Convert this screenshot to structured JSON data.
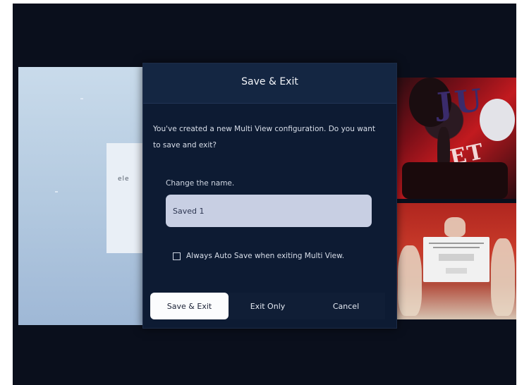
{
  "left_preview": {
    "card_text": "ele"
  },
  "right_top": {
    "letters": "JU",
    "letters2": "ET"
  },
  "dialog": {
    "title": "Save & Exit",
    "message": "You've created a new Multi View configuration. Do you want to save and exit?",
    "name_label": "Change the name.",
    "name_value": "Saved 1",
    "checkbox_label": "Always Auto Save when exiting Multi View.",
    "checkbox_checked": false,
    "buttons": {
      "save_exit": "Save & Exit",
      "exit_only": "Exit Only",
      "cancel": "Cancel"
    }
  },
  "colors": {
    "screen_bg": "#0a0f1c",
    "dialog_bg": "#0d1b33",
    "dialog_header": "#142642",
    "input_bg": "#c8cfe3",
    "primary_button": "#fbfcfd"
  }
}
